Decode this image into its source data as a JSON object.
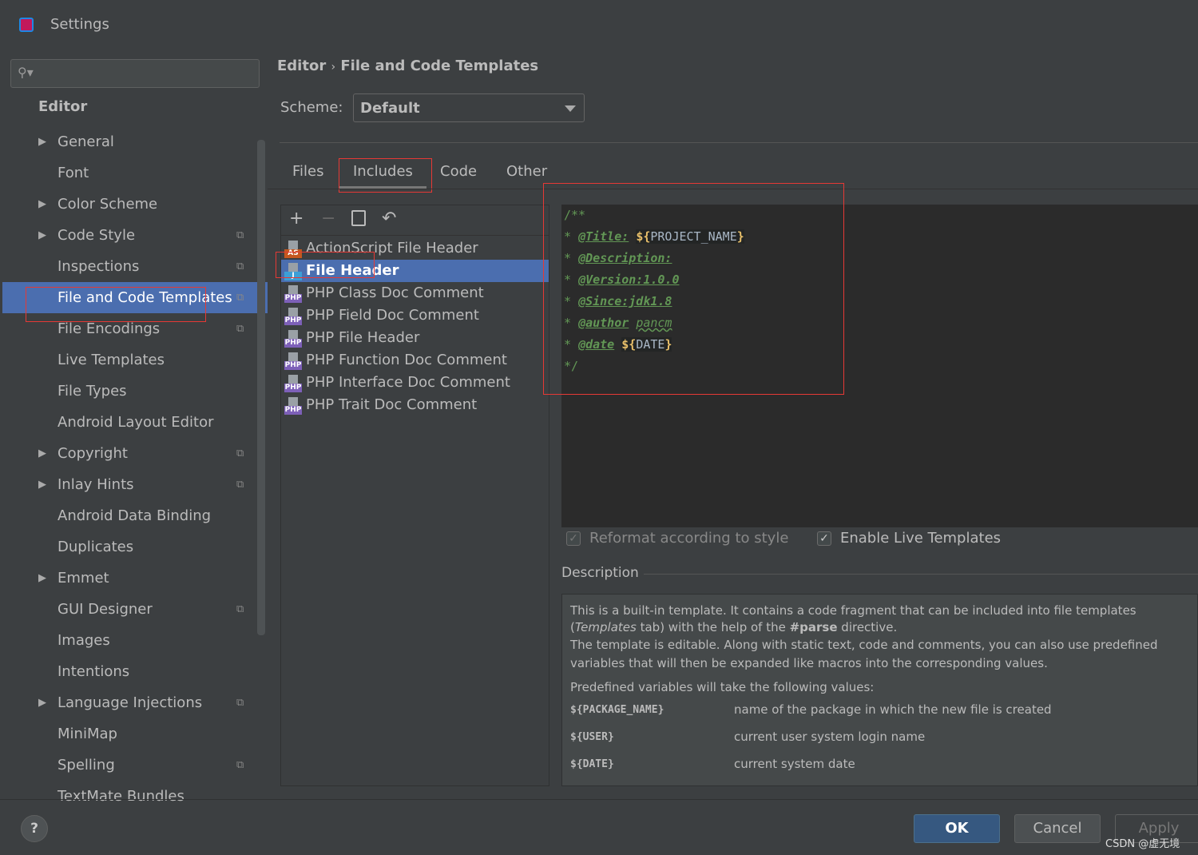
{
  "window": {
    "title": "Settings"
  },
  "search": {
    "placeholder": ""
  },
  "sidebar": {
    "section": "Editor",
    "items": [
      {
        "label": "General",
        "arrow": true,
        "copy": false
      },
      {
        "label": "Font",
        "arrow": false,
        "copy": false
      },
      {
        "label": "Color Scheme",
        "arrow": true,
        "copy": false
      },
      {
        "label": "Code Style",
        "arrow": true,
        "copy": true
      },
      {
        "label": "Inspections",
        "arrow": false,
        "copy": true
      },
      {
        "label": "File and Code Templates",
        "arrow": false,
        "copy": true,
        "selected": true
      },
      {
        "label": "File Encodings",
        "arrow": false,
        "copy": true
      },
      {
        "label": "Live Templates",
        "arrow": false,
        "copy": false
      },
      {
        "label": "File Types",
        "arrow": false,
        "copy": false
      },
      {
        "label": "Android Layout Editor",
        "arrow": false,
        "copy": false
      },
      {
        "label": "Copyright",
        "arrow": true,
        "copy": true
      },
      {
        "label": "Inlay Hints",
        "arrow": true,
        "copy": true
      },
      {
        "label": "Android Data Binding",
        "arrow": false,
        "copy": false
      },
      {
        "label": "Duplicates",
        "arrow": false,
        "copy": false
      },
      {
        "label": "Emmet",
        "arrow": true,
        "copy": false
      },
      {
        "label": "GUI Designer",
        "arrow": false,
        "copy": true
      },
      {
        "label": "Images",
        "arrow": false,
        "copy": false
      },
      {
        "label": "Intentions",
        "arrow": false,
        "copy": false
      },
      {
        "label": "Language Injections",
        "arrow": true,
        "copy": true
      },
      {
        "label": "MiniMap",
        "arrow": false,
        "copy": false
      },
      {
        "label": "Spelling",
        "arrow": false,
        "copy": true
      },
      {
        "label": "TextMate Bundles",
        "arrow": false,
        "copy": false
      }
    ]
  },
  "breadcrumb": {
    "parent": "Editor",
    "sep": "›",
    "current": "File and Code Templates"
  },
  "scheme": {
    "label": "Scheme:",
    "value": "Default"
  },
  "tabs": [
    {
      "label": "Files"
    },
    {
      "label": "Includes",
      "active": true
    },
    {
      "label": "Code"
    },
    {
      "label": "Other"
    }
  ],
  "toolbar": {
    "add": "+",
    "remove": "−",
    "copy": "copy-icon",
    "reset": "↶"
  },
  "templates": [
    {
      "label": "ActionScript File Header",
      "badge": "AS",
      "color": "#c4581f"
    },
    {
      "label": "File Header",
      "badge": "J",
      "color": "#3d9fd6",
      "selected": true
    },
    {
      "label": "PHP Class Doc Comment",
      "badge": "PHP",
      "color": "#7d60b8"
    },
    {
      "label": "PHP Field Doc Comment",
      "badge": "PHP",
      "color": "#7d60b8"
    },
    {
      "label": "PHP File Header",
      "badge": "PHP",
      "color": "#7d60b8"
    },
    {
      "label": "PHP Function Doc Comment",
      "badge": "PHP",
      "color": "#7d60b8"
    },
    {
      "label": "PHP Interface Doc Comment",
      "badge": "PHP",
      "color": "#7d60b8"
    },
    {
      "label": "PHP Trait Doc Comment",
      "badge": "PHP",
      "color": "#7d60b8"
    }
  ],
  "code": {
    "open": "/**",
    "star": "* ",
    "close": "*/",
    "title_tag": "@Title:",
    "title_var": "PROJECT_NAME",
    "desc_tag": "@Description:",
    "version_tag": "@Version:1.0.0",
    "since_tag": "@Since:jdk1.8",
    "author_tag": "@author",
    "author_val": "pancm",
    "date_tag": "@date",
    "date_var": "DATE",
    "dollar": "$",
    "lbrace": "{",
    "rbrace": "}"
  },
  "options": {
    "reformat": {
      "label": "Reformat according to style",
      "checked": true,
      "disabled": true
    },
    "live": {
      "label": "Enable Live Templates",
      "checked": true
    }
  },
  "description": {
    "label": "Description",
    "p1a": "This is a built-in template. It contains a code fragment that can be included into file templates (",
    "p1b": "Templates",
    "p1c": " tab) with the help of the ",
    "p1d": "#parse",
    "p1e": " directive.",
    "p2": "The template is editable. Along with static text, code and comments, you can also use predefined variables that will then be expanded like macros into the corresponding values.",
    "p3": "Predefined variables will take the following values:",
    "vars": [
      {
        "name": "${PACKAGE_NAME}",
        "desc": "name of the package in which the new file is created"
      },
      {
        "name": "${USER}",
        "desc": "current user system login name"
      },
      {
        "name": "${DATE}",
        "desc": "current system date"
      }
    ]
  },
  "buttons": {
    "help": "?",
    "ok": "OK",
    "cancel": "Cancel",
    "apply": "Apply"
  },
  "watermark": "CSDN @虚无境"
}
